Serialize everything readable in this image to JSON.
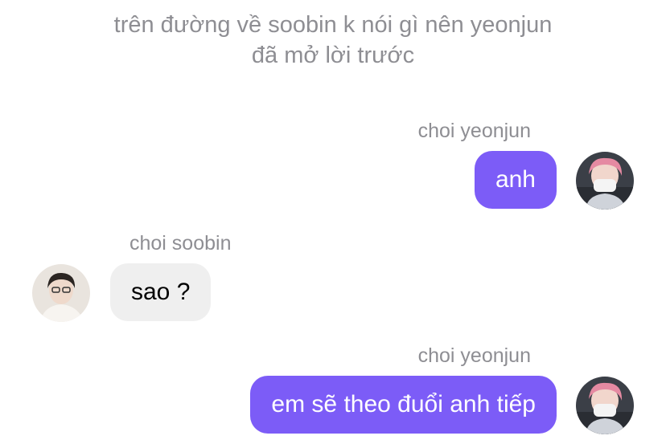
{
  "narration": {
    "line1": "trên đường về soobin k nói gì nên yeonjun",
    "line2": "đã mở lời trước"
  },
  "messages": [
    {
      "sender": "choi yeonjun",
      "text": "anh",
      "direction": "outgoing",
      "avatar": "yeonjun-avatar"
    },
    {
      "sender": "choi soobin",
      "text": "sao ?",
      "direction": "incoming",
      "avatar": "soobin-avatar"
    },
    {
      "sender": "choi yeonjun",
      "text": "em sẽ theo đuổi anh tiếp",
      "direction": "outgoing",
      "avatar": "yeonjun-avatar"
    }
  ],
  "colors": {
    "outgoing_bubble": "#7c5cf7",
    "incoming_bubble": "#efefef",
    "meta_text": "#8e8e93"
  }
}
